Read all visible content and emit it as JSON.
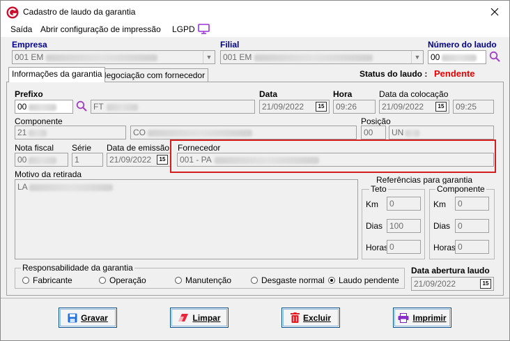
{
  "window": {
    "title": "Cadastro de laudo da garantia"
  },
  "menu": {
    "items": [
      "Saída",
      "Abrir configuração de impressão",
      "LGPD"
    ]
  },
  "header": {
    "empresa_label": "Empresa",
    "empresa_value": "001 EM",
    "filial_label": "Filial",
    "filial_value": "001 EM",
    "numero_label": "Número do laudo",
    "numero_value": "00"
  },
  "tabs": [
    "Informações da garantia",
    "Negociação com fornecedor"
  ],
  "status": {
    "label": "Status do laudo :",
    "value": "Pendente",
    "color": "#e60000"
  },
  "form": {
    "prefixo_label": "Prefixo",
    "prefixo_value": "00",
    "prefixo_desc": "FT",
    "data_label": "Data",
    "data_value": "21/09/2022",
    "hora_label": "Hora",
    "hora_value": "09:26",
    "data_colocacao_label": "Data da colocação",
    "data_colocacao_value": "21/09/2022",
    "hora_colocacao_value": "09:25",
    "componente_label": "Componente",
    "componente_code": "21",
    "componente_desc": "CO",
    "posicao_label": "Posição",
    "posicao_code": "00",
    "posicao_desc": "UN",
    "nota_label": "Nota fiscal",
    "nota_value": "00",
    "serie_label": "Série",
    "serie_value": "1",
    "data_emissao_label": "Data de emissão",
    "data_emissao_value": "21/09/2022",
    "fornecedor_label": "Fornecedor",
    "fornecedor_value": "001 - PA",
    "motivo_label": "Motivo da retirada",
    "motivo_value": "LA"
  },
  "referencias": {
    "title": "Referências para garantia",
    "teto": {
      "title": "Teto",
      "km_label": "Km",
      "km_value": "0",
      "dias_label": "Dias",
      "dias_value": "100",
      "horas_label": "Horas",
      "horas_value": "0"
    },
    "componente": {
      "title": "Componente",
      "km_label": "Km",
      "km_value": "0",
      "dias_label": "Dias",
      "dias_value": "0",
      "horas_label": "Horas",
      "horas_value": "0"
    }
  },
  "responsabilidade": {
    "title": "Responsabilidade da garantia",
    "options": [
      "Fabricante",
      "Operação",
      "Manutenção",
      "Desgaste normal",
      "Laudo pendente"
    ],
    "selected_index": 4
  },
  "abertura": {
    "label": "Data abertura laudo",
    "value": "21/09/2022"
  },
  "calendar_icon_text": "15",
  "buttons": {
    "gravar": "Gravar",
    "limpar": "Limpar",
    "excluir": "Excluir",
    "imprimir": "Imprimir"
  },
  "icons": {
    "app": "app-logo-icon",
    "close": "close-icon",
    "lgpd": "monitor-icon",
    "search": "magnifier-icon"
  },
  "colors": {
    "accent": "#00008b",
    "highlight": "#d41e1e",
    "lgpd_icon": "#9b30d9",
    "search_icon": "#a040c0"
  }
}
